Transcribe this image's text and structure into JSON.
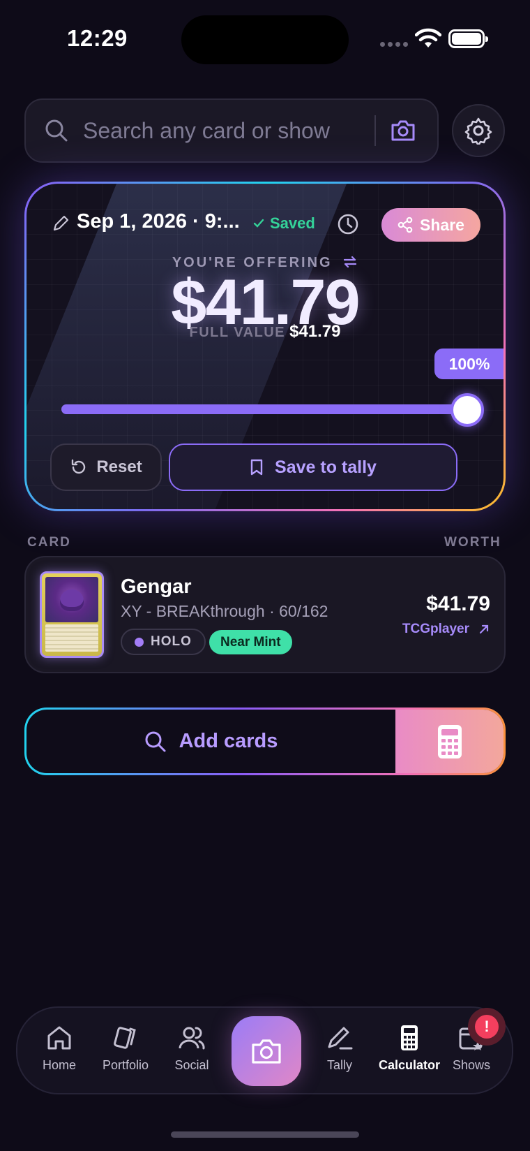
{
  "status_bar": {
    "time": "12:29"
  },
  "search": {
    "placeholder": "Search any card or show"
  },
  "offer": {
    "date": "Sep 1, 2026 · 9:...",
    "saved": "Saved",
    "share": "Share",
    "label": "YOU'RE OFFERING",
    "amount": "$41.79",
    "full_value_label": "FULL VALUE",
    "full_value": "$41.79",
    "percent_label": "100%",
    "percent": 100,
    "reset": "Reset",
    "save_to_tally": "Save to tally"
  },
  "list": {
    "col_card": "CARD",
    "col_worth": "WORTH",
    "items": [
      {
        "name": "Gengar",
        "set": "XY - BREAKthrough · 60/162",
        "finish": "HOLO",
        "condition": "Near Mint",
        "price": "$41.79",
        "source": "TCGplayer"
      }
    ]
  },
  "add_cards": {
    "label": "Add cards"
  },
  "tabs": [
    {
      "label": "Home",
      "icon": "home-icon"
    },
    {
      "label": "Portfolio",
      "icon": "cards-icon"
    },
    {
      "label": "Social",
      "icon": "users-icon"
    },
    {
      "label": "",
      "icon": "camera-icon"
    },
    {
      "label": "Tally",
      "icon": "pencil-icon"
    },
    {
      "label": "Calculator",
      "icon": "calculator-icon",
      "active": true
    },
    {
      "label": "Shows",
      "icon": "calendar-star-icon"
    }
  ],
  "alert_badge": "!",
  "colors": {
    "accent": "#8b6cf7",
    "background": "#0e0b18",
    "success": "#34d399",
    "condition": "#3fe0a8",
    "alert": "#f43f5e"
  }
}
